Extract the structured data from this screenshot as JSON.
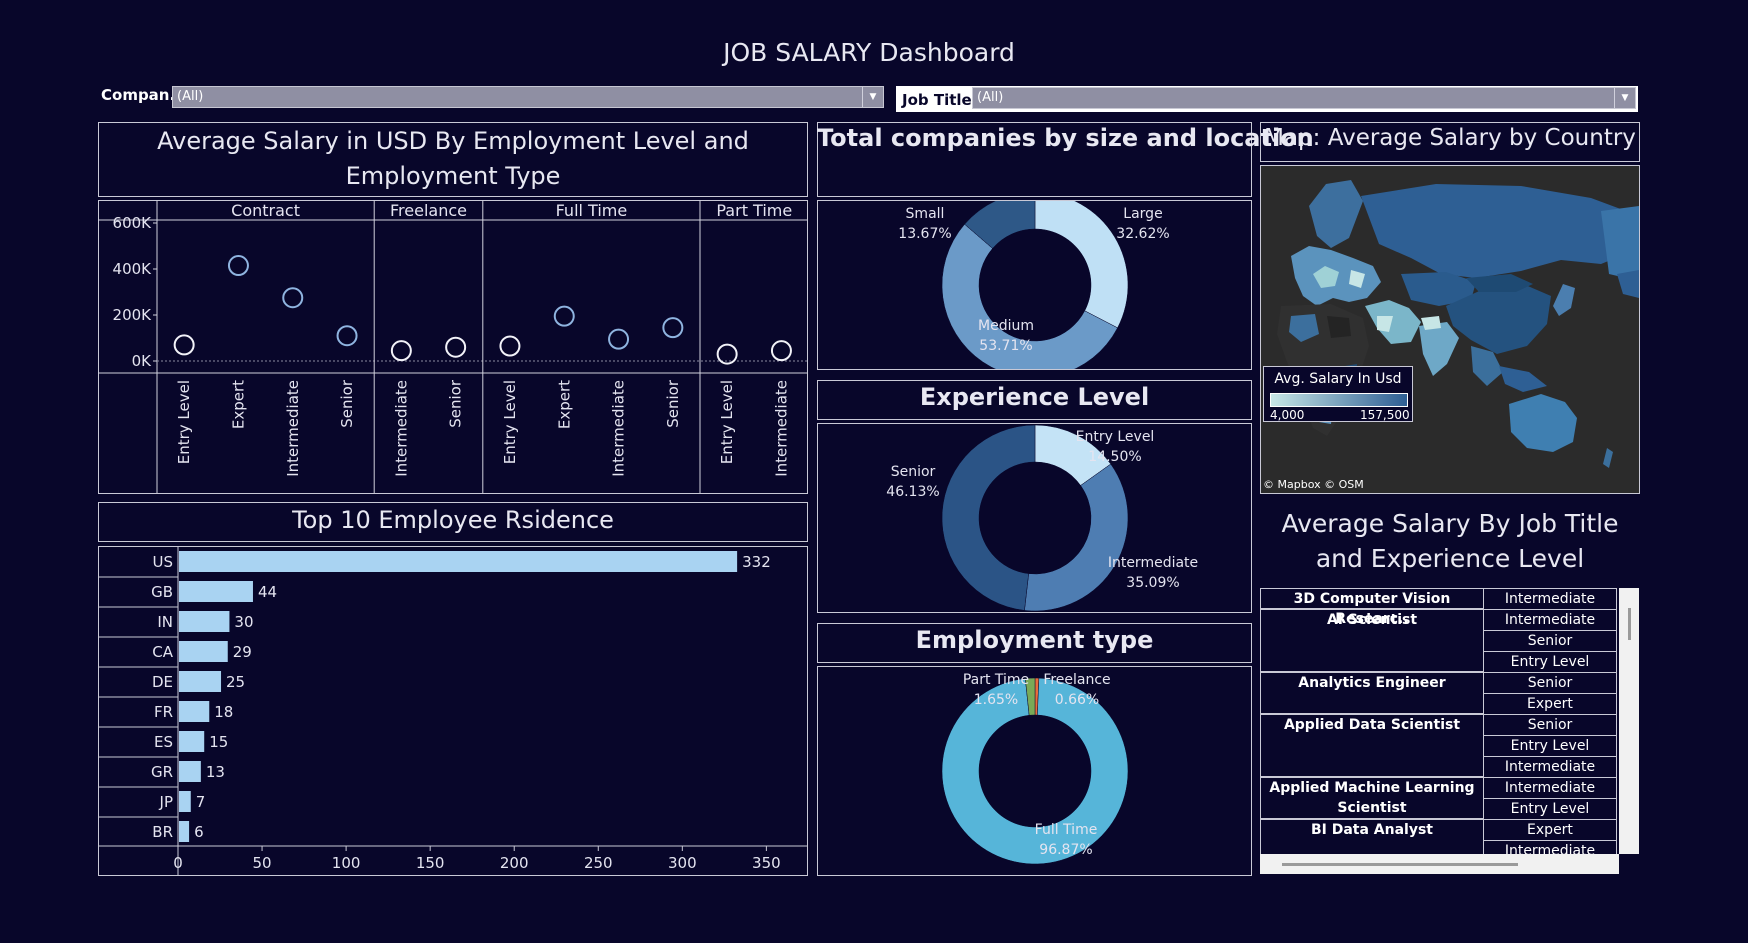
{
  "header": {
    "title": "JOB SALARY Dashboard"
  },
  "filters": {
    "company": {
      "label": "Compan..",
      "value": "(All)"
    },
    "job_title": {
      "label": "Job Title",
      "value": "(All)"
    }
  },
  "panels": {
    "salary_level_title": "Average Salary in USD By Employment Level and Employment Type",
    "residence_title": "Top 10 Employee Rsidence",
    "company_size_title": "Total companies  by size and location",
    "experience_title": "Experience Level",
    "employment_type_title": "Employment type",
    "map_title": "Map: Average Salary by Country",
    "job_table_title": "Average Salary By Job Title and Experience Level"
  },
  "map": {
    "legend_title": "Avg. Salary In Usd",
    "legend_min": "4,000",
    "legend_max": "157,500",
    "legend_colors": [
      "#c7e6e6",
      "#2e5f94"
    ],
    "attribution": "© Mapbox © OSM"
  },
  "chart_data": [
    {
      "type": "scatter",
      "ylim": [
        0,
        600000
      ],
      "yticks": [
        {
          "value": 0,
          "label": "0K"
        },
        {
          "value": 200000,
          "label": "200K"
        },
        {
          "value": 400000,
          "label": "400K"
        },
        {
          "value": 600000,
          "label": "600K"
        }
      ],
      "panels": [
        {
          "name": "Contract",
          "points": [
            {
              "level": "Entry Level",
              "value": 70000
            },
            {
              "level": "Expert",
              "value": 415000
            },
            {
              "level": "Intermediate",
              "value": 275000
            },
            {
              "level": "Senior",
              "value": 110000
            }
          ]
        },
        {
          "name": "Freelance",
          "points": [
            {
              "level": "Intermediate",
              "value": 45000
            },
            {
              "level": "Senior",
              "value": 60000
            }
          ]
        },
        {
          "name": "Full Time",
          "points": [
            {
              "level": "Entry Level",
              "value": 65000
            },
            {
              "level": "Expert",
              "value": 195000
            },
            {
              "level": "Intermediate",
              "value": 95000
            },
            {
              "level": "Senior",
              "value": 145000
            }
          ]
        },
        {
          "name": "Part Time",
          "points": [
            {
              "level": "Entry Level",
              "value": 30000
            },
            {
              "level": "Intermediate",
              "value": 45000
            }
          ]
        }
      ]
    },
    {
      "type": "bar",
      "categories": [
        "US",
        "GB",
        "IN",
        "CA",
        "DE",
        "FR",
        "ES",
        "GR",
        "JP",
        "BR"
      ],
      "values": [
        332,
        44,
        30,
        29,
        25,
        18,
        15,
        13,
        7,
        6
      ],
      "xlim": [
        0,
        370
      ],
      "xticks": [
        0,
        50,
        100,
        150,
        200,
        250,
        300,
        350
      ],
      "color": "#a9d3f2"
    },
    {
      "type": "pie",
      "slices": [
        {
          "label": "Large",
          "pct": "32.62%",
          "value": 32.62,
          "color": "#bfe0f5"
        },
        {
          "label": "Medium",
          "pct": "53.71%",
          "value": 53.71,
          "color": "#6b9ac8"
        },
        {
          "label": "Small",
          "pct": "13.67%",
          "value": 13.67,
          "color": "#2e5887"
        }
      ]
    },
    {
      "type": "pie",
      "slices": [
        {
          "label": "Entry Level",
          "pct": "14.50%",
          "value": 14.5,
          "color": "#c4e3f6"
        },
        {
          "label": "Intermediate",
          "pct": "35.09%",
          "value": 35.09,
          "color": "#4e7db2"
        },
        {
          "label": "Senior",
          "pct": "46.13%",
          "value": 46.13,
          "color": "#2b5486"
        }
      ]
    },
    {
      "type": "pie",
      "slices": [
        {
          "label": "Freelance",
          "pct": "0.66%",
          "value": 0.66,
          "color": "#e86c3c"
        },
        {
          "label": "Full Time",
          "pct": "96.87%",
          "value": 96.87,
          "color": "#56b5d9"
        },
        {
          "label": "Part Time",
          "pct": "1.65%",
          "value": 1.65,
          "color": "#7aa957"
        }
      ]
    },
    {
      "type": "table",
      "rows": [
        {
          "title": "3D Computer Vision Researc..",
          "levels": [
            "Intermediate"
          ]
        },
        {
          "title": "AI Scientist",
          "levels": [
            "Intermediate",
            "Senior",
            "Entry Level"
          ]
        },
        {
          "title": "Analytics Engineer",
          "levels": [
            "Senior",
            "Expert"
          ]
        },
        {
          "title": "Applied Data Scientist",
          "levels": [
            "Senior",
            "Entry Level",
            "Intermediate"
          ]
        },
        {
          "title": "Applied Machine Learning Scientist",
          "levels": [
            "Intermediate",
            "Entry Level"
          ]
        },
        {
          "title": "BI Data Analyst",
          "levels": [
            "Expert",
            "Intermediate"
          ]
        }
      ]
    }
  ]
}
